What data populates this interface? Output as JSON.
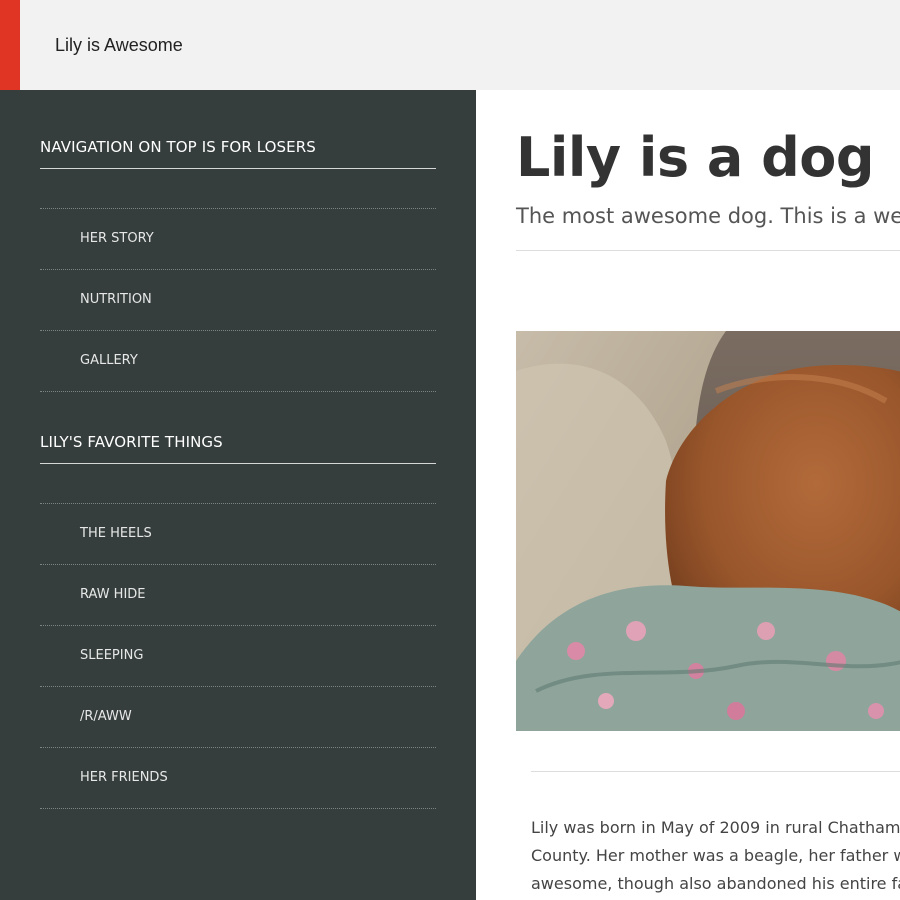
{
  "header": {
    "site_title": "Lily is Awesome",
    "accent_color": "#e03524"
  },
  "sidebar": {
    "sections": [
      {
        "heading": "NAVIGATION ON TOP IS FOR LOSERS",
        "items": [
          {
            "label": "HER STORY"
          },
          {
            "label": "NUTRITION"
          },
          {
            "label": "GALLERY"
          }
        ]
      },
      {
        "heading": "LILY'S FAVORITE THINGS",
        "items": [
          {
            "label": "THE HEELS"
          },
          {
            "label": "RAW HIDE"
          },
          {
            "label": "SLEEPING"
          },
          {
            "label": "/R/AWW"
          },
          {
            "label": "HER FRIENDS"
          }
        ]
      }
    ]
  },
  "main": {
    "title": "Lily is a dog",
    "subtitle": "The most awesome dog. This is a webs",
    "photo_icon": "sleeping-dog-photo",
    "body_lines": [
      "Lily was born in May of 2009 in rural Chatham",
      "County. Her mother was a beagle, her father wa",
      "awesome, though also abandoned his entire fa"
    ]
  },
  "colors": {
    "sidebar_bg": "#363e3d",
    "topbar_bg": "#f2f2f2",
    "title_text": "#333333"
  }
}
